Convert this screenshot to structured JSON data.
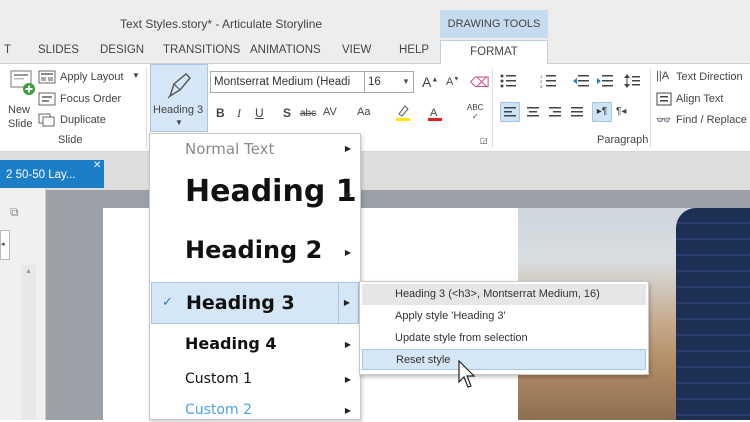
{
  "window": {
    "title": "Text Styles.story* - Articulate Storyline"
  },
  "contextual": {
    "label": "DRAWING TOOLS"
  },
  "tabs": [
    "T",
    "SLIDES",
    "DESIGN",
    "TRANSITIONS",
    "ANIMATIONS",
    "VIEW",
    "HELP"
  ],
  "active_tab": "FORMAT",
  "slide_group": {
    "new_slide": "New",
    "new_slide2": "Slide",
    "apply_layout": "Apply Layout",
    "focus_order": "Focus Order",
    "duplicate": "Duplicate",
    "group_label": "Slide"
  },
  "heading_button": {
    "label": "Heading 3"
  },
  "font": {
    "name": "Montserrat Medium (Headi",
    "size": "16"
  },
  "paragraph": {
    "group_label": "Paragraph",
    "text_direction": "Text Direction",
    "align_text": "Align Text",
    "find_replace": "Find / Replace"
  },
  "document_tab": {
    "label": "2 50-50 Lay..."
  },
  "heading_menu": {
    "items": [
      {
        "label": "Normal Text"
      },
      {
        "label": "Heading 1"
      },
      {
        "label": "Heading 2"
      },
      {
        "label": "Heading 3",
        "checked": true
      },
      {
        "label": "Heading 4"
      },
      {
        "label": "Custom 1"
      },
      {
        "label": "Custom 2"
      }
    ]
  },
  "sub_menu": {
    "items": [
      {
        "label": "Heading 3 (<h3>, Montserrat Medium, 16)"
      },
      {
        "label": "Apply style 'Heading 3'"
      },
      {
        "label": "Update style from selection"
      },
      {
        "label": "Reset style"
      }
    ]
  },
  "colors": {
    "accent": "#1d7ec8",
    "contextual": "#c5dcf0",
    "highlight": "#d5e6f6",
    "custom2": "#4aa3df"
  }
}
